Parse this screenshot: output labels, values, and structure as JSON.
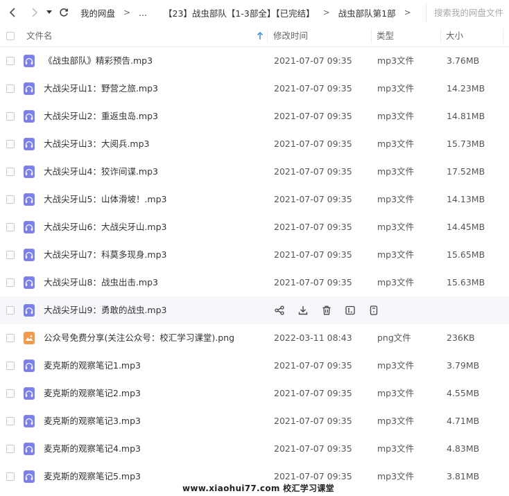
{
  "toolbar": {
    "breadcrumbs": [
      "我的网盘",
      "...",
      "【23】战虫部队【1-3部全】【已完结】",
      "战虫部队第1部"
    ],
    "separator": ">",
    "search_placeholder": "搜索我的网盘文件",
    "back_icon": "chevron-left-icon",
    "forward_icon": "chevron-right-icon",
    "history_icon": "caret-down-icon",
    "refresh_icon": "refresh-icon"
  },
  "table": {
    "columns": {
      "name": "文件名",
      "modified": "修改时间",
      "type": "类型",
      "size": "大小"
    },
    "sort": {
      "column": "name",
      "direction": "ascending"
    },
    "files": [
      {
        "name": "《战虫部队》精彩预告.mp3",
        "modified": "2021-07-07 09:35",
        "type": "mp3文件",
        "size": "3.76MB",
        "icon": "audio-file-icon"
      },
      {
        "name": "大战尖牙山1：野营之旅.mp3",
        "modified": "2021-07-07 09:35",
        "type": "mp3文件",
        "size": "14.23MB",
        "icon": "audio-file-icon"
      },
      {
        "name": "大战尖牙山2：重返虫岛.mp3",
        "modified": "2021-07-07 09:35",
        "type": "mp3文件",
        "size": "14.81MB",
        "icon": "audio-file-icon"
      },
      {
        "name": "大战尖牙山3：大阅兵.mp3",
        "modified": "2021-07-07 09:35",
        "type": "mp3文件",
        "size": "15.73MB",
        "icon": "audio-file-icon"
      },
      {
        "name": "大战尖牙山4：狡诈间谍.mp3",
        "modified": "2021-07-07 09:35",
        "type": "mp3文件",
        "size": "17.52MB",
        "icon": "audio-file-icon"
      },
      {
        "name": "大战尖牙山5：山体滑坡！.mp3",
        "modified": "2021-07-07 09:35",
        "type": "mp3文件",
        "size": "14.13MB",
        "icon": "audio-file-icon"
      },
      {
        "name": "大战尖牙山6：大战尖牙山.mp3",
        "modified": "2021-07-07 09:35",
        "type": "mp3文件",
        "size": "14.45MB",
        "icon": "audio-file-icon"
      },
      {
        "name": "大战尖牙山7：科莫多现身.mp3",
        "modified": "2021-07-07 09:35",
        "type": "mp3文件",
        "size": "15.65MB",
        "icon": "audio-file-icon"
      },
      {
        "name": "大战尖牙山8：战虫出击.mp3",
        "modified": "2021-07-07 09:35",
        "type": "mp3文件",
        "size": "15.63MB",
        "icon": "audio-file-icon"
      },
      {
        "name": "大战尖牙山9：勇敢的战虫.mp3",
        "modified": "",
        "type": "",
        "size": "",
        "icon": "audio-file-icon",
        "hovered": true
      },
      {
        "name": "公众号免费分享(关注公众号：校汇学习课堂).png",
        "modified": "2022-03-11 08:43",
        "type": "png文件",
        "size": "236KB",
        "icon": "image-file-icon"
      },
      {
        "name": "麦克斯的观察笔记1.mp3",
        "modified": "2021-07-07 09:35",
        "type": "mp3文件",
        "size": "3.79MB",
        "icon": "audio-file-icon"
      },
      {
        "name": "麦克斯的观察笔记2.mp3",
        "modified": "2021-07-07 09:35",
        "type": "mp3文件",
        "size": "4.55MB",
        "icon": "audio-file-icon"
      },
      {
        "name": "麦克斯的观察笔记3.mp3",
        "modified": "2021-07-07 09:35",
        "type": "mp3文件",
        "size": "4.71MB",
        "icon": "audio-file-icon"
      },
      {
        "name": "麦克斯的观察笔记4.mp3",
        "modified": "2021-07-07 09:35",
        "type": "mp3文件",
        "size": "4.83MB",
        "icon": "audio-file-icon"
      },
      {
        "name": "麦克斯的观察笔记5.mp3",
        "modified": "2021-07-07 09:35",
        "type": "mp3文件",
        "size": "3.81MB",
        "icon": "audio-file-icon"
      }
    ],
    "hover_actions": [
      "share-icon",
      "download-icon",
      "delete-icon",
      "rename-icon",
      "more-icon"
    ]
  },
  "watermark": "www.xiaohui77.com  校汇学习课堂",
  "colors": {
    "audio_icon": "#7b7ff0",
    "image_icon": "#f39a4a",
    "hover_row": "#f5f7fb",
    "sort_arrow": "#4a90e2"
  }
}
